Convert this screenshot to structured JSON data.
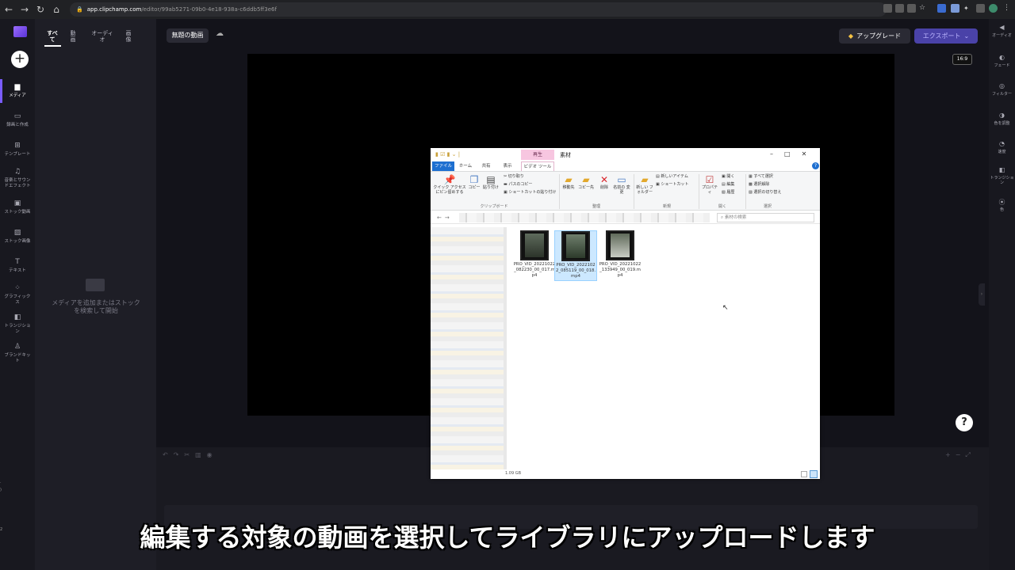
{
  "browser": {
    "url_host": "app.clipchamp.com",
    "url_path": "/editor/99ab5271-09b0-4e18-938a-c6ddb5ff3e6f"
  },
  "leftrail": {
    "items": [
      {
        "label": "メディア",
        "icon": "folder-icon"
      },
      {
        "label": "録画と作成",
        "icon": "camera-icon"
      },
      {
        "label": "テンプレート",
        "icon": "template-icon"
      },
      {
        "label": "音楽とサウンドエフェクト",
        "icon": "music-icon"
      },
      {
        "label": "ストック動画",
        "icon": "film-icon"
      },
      {
        "label": "ストック画像",
        "icon": "image-icon"
      },
      {
        "label": "テキスト",
        "icon": "text-icon"
      },
      {
        "label": "グラフィックス",
        "icon": "shapes-icon"
      },
      {
        "label": "トランジション",
        "icon": "transition-icon"
      },
      {
        "label": "ブランドキット",
        "icon": "brand-icon"
      }
    ]
  },
  "panel": {
    "tabs": [
      "すべて",
      "動画",
      "オーディオ",
      "画像"
    ],
    "empty_text": "メディアを追加またはストックを検索して開始"
  },
  "header": {
    "title": "無題の動画",
    "upgrade_label": "アップグレード",
    "export_label": "エクスポート"
  },
  "preview": {
    "ratio": "16:9",
    "help": "?"
  },
  "rightrail": {
    "items": [
      {
        "label": "オーディオ",
        "icon": "speaker-icon"
      },
      {
        "label": "フェード",
        "icon": "fade-icon"
      },
      {
        "label": "フィルター",
        "icon": "filter-icon"
      },
      {
        "label": "色を調整",
        "icon": "contrast-icon"
      },
      {
        "label": "速度",
        "icon": "speed-icon"
      },
      {
        "label": "トランジション",
        "icon": "transition-icon"
      },
      {
        "label": "色",
        "icon": "palette-icon"
      }
    ]
  },
  "explorer": {
    "context_tab": "再生",
    "folder_name": "素材",
    "tabs": [
      "ファイル",
      "ホーム",
      "共有",
      "表示",
      "ビデオ ツール"
    ],
    "ribbon": {
      "pin": "クイック アクセス にピン留めする",
      "copy": "コピー",
      "paste": "貼り付け",
      "cut": "切り取り",
      "copy_path": "パスのコピー",
      "paste_shortcut": "ショートカットの貼り付け",
      "move_to": "移動先",
      "copy_to": "コピー先",
      "delete": "削除",
      "rename": "名前の 変更",
      "new_folder": "新しい フォルダー",
      "new_item": "新しいアイテム",
      "easy_access": "ショートカット",
      "properties": "プロパティ",
      "open": "開く",
      "edit": "編集",
      "history": "履歴",
      "select_all": "すべて選択",
      "select_none": "選択解除",
      "invert_selection": "選択の切り替え",
      "groups": [
        "クリップボード",
        "整理",
        "新規",
        "開く",
        "選択"
      ]
    },
    "search_placeholder": "素材の検索",
    "files": [
      {
        "name": "PRO_VID_20221022_082230_00_017.mp4",
        "selected": false
      },
      {
        "name": "PRO_VID_20221022_085119_00_018.mp4",
        "selected": true
      },
      {
        "name": "PRO_VID_20221022_133949_00_019.mp4",
        "selected": false
      }
    ],
    "status_size": "1.09 GB"
  },
  "subtitle": "編集する対象の動画を選択してライブラリにアップロードします"
}
